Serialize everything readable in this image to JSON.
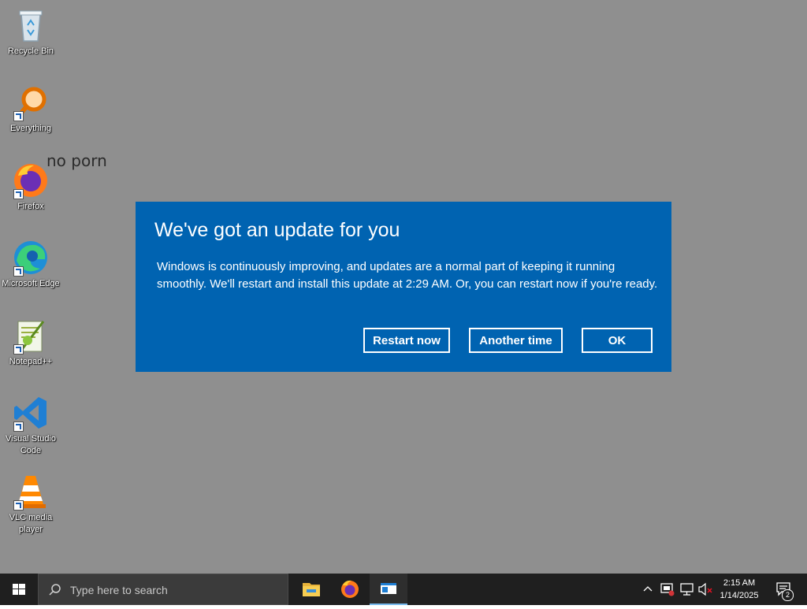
{
  "desktop": {
    "icons": [
      {
        "label": "Recycle Bin",
        "name": "recycle-bin-icon"
      },
      {
        "label": "Everything",
        "name": "everything-search-icon"
      },
      {
        "label": "Firefox",
        "name": "firefox-icon"
      },
      {
        "label": "Microsoft Edge",
        "name": "edge-icon"
      },
      {
        "label": "Notepad++",
        "name": "notepad-plus-plus-icon"
      },
      {
        "label": "Visual Studio Code",
        "name": "vscode-icon"
      },
      {
        "label": "VLC media player",
        "name": "vlc-icon"
      }
    ],
    "overlay_note": "no porn"
  },
  "dialog": {
    "title": "We've got an update for you",
    "body": "Windows is continuously improving, and updates are a normal part of keeping it running smoothly. We'll restart and install this update at 2:29 AM. Or, you can restart now if you're ready.",
    "buttons": {
      "restart_now": "Restart now",
      "another_time": "Another time",
      "ok": "OK"
    },
    "background": "#0063b1"
  },
  "taskbar": {
    "search_placeholder": "Type here to search",
    "pinned": [
      "file-explorer-icon",
      "firefox-icon",
      "app-window-icon"
    ],
    "tray": {
      "time": "2:15 AM",
      "date": "1/14/2025",
      "notification_count": "2"
    }
  }
}
